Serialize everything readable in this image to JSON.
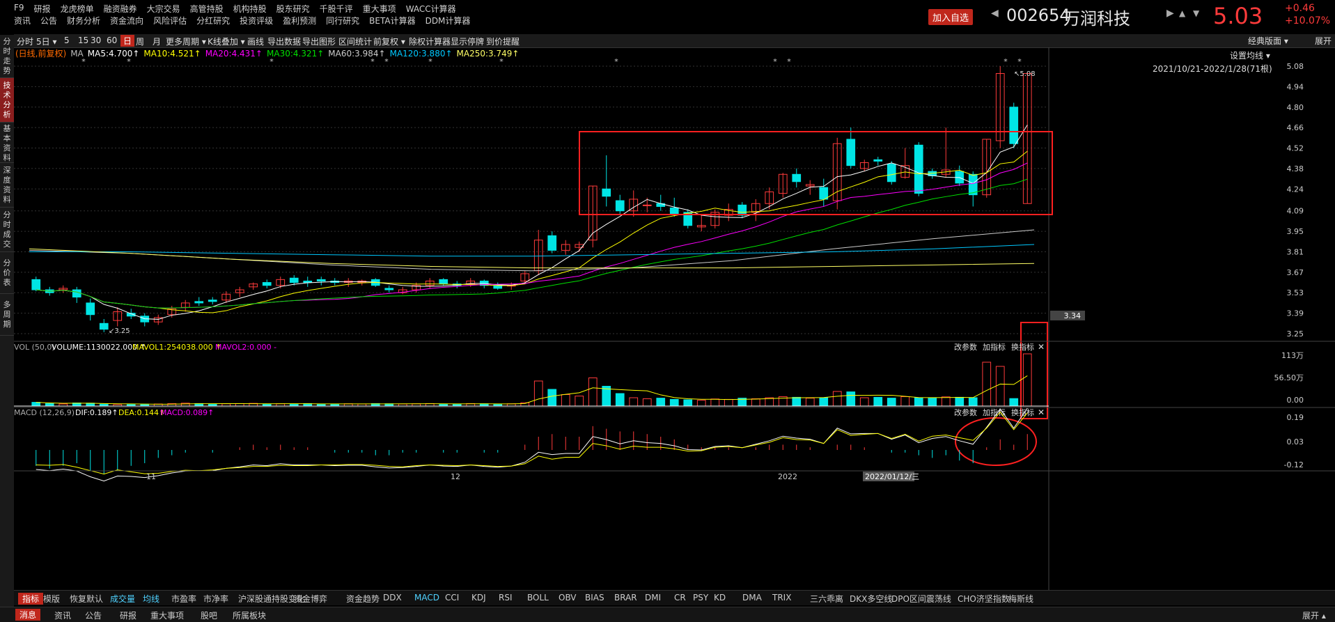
{
  "topnav": {
    "row1": [
      "F9",
      "研报",
      "龙虎榜单",
      "融资融券",
      "大宗交易",
      "高管持股",
      "机构持股",
      "股东研究",
      "千股千评",
      "重大事项",
      "WACC计算器"
    ],
    "row2": [
      "资讯",
      "公告",
      "财务分析",
      "资金流向",
      "风险评估",
      "分红研究",
      "投资评级",
      "盈利预测",
      "同行研究",
      "BETA计算器",
      "DDM计算器"
    ],
    "add_watch": "加入自选",
    "code": "002654",
    "name": "万润科技",
    "price": "5.03",
    "change": "+0.46",
    "change_pct": "+10.07%",
    "price_color": "#ff3b3b"
  },
  "left_tabs": [
    "分时走势",
    "技术分析",
    "基本资料",
    "深度资料",
    "分时成交",
    "分价表",
    "多周期"
  ],
  "toolbar": {
    "items": [
      "分时",
      "5日",
      "5",
      "15",
      "30",
      "60",
      "日",
      "周",
      "月",
      "更多周期",
      "K线叠加",
      "画线",
      "导出数据",
      "导出图形",
      "区间统计",
      "前复权",
      "除权计算器",
      "显示停牌",
      "到价提醒"
    ],
    "active": "日",
    "right_label": "经典版面",
    "expand": "展开"
  },
  "ma_legend": {
    "mode": "(日线,前复权)",
    "items": [
      {
        "label": "MA",
        "color": "#bbbbbb"
      },
      {
        "label": "MA5:4.700↑",
        "color": "#ffffff"
      },
      {
        "label": "MA10:4.521↑",
        "color": "#ffff00"
      },
      {
        "label": "MA20:4.431↑",
        "color": "#ff00ff"
      },
      {
        "label": "MA30:4.321↑",
        "color": "#00e000"
      },
      {
        "label": "MA60:3.984↑",
        "color": "#cccccc"
      },
      {
        "label": "MA120:3.880↑",
        "color": "#00c8ff"
      },
      {
        "label": "MA250:3.749↑",
        "color": "#ffff66"
      }
    ],
    "settings": "设置均线",
    "range": "2021/10/21-2022/1/28(71根)"
  },
  "price_axis": [
    "5.08",
    "4.94",
    "4.80",
    "4.66",
    "4.52",
    "4.38",
    "4.24",
    "4.09",
    "3.95",
    "3.81",
    "3.67",
    "3.53",
    "3.39",
    "3.25"
  ],
  "price_current_tag": "3.34",
  "annotations": {
    "high": "5.08",
    "low": "3.25"
  },
  "volume": {
    "title": "VOL (50,0)",
    "volume": "VOLUME:1130022.000 ↑",
    "mavol1": "MAVOL1:254038.000 ↑",
    "mavol2": "MAVOL2:0.000 -",
    "axis": [
      "113万",
      "56.50万",
      "0.00"
    ],
    "buttons": [
      "改参数",
      "加指标",
      "换指标"
    ]
  },
  "macd": {
    "title": "MACD (12,26,9)",
    "dif": "DIF:0.189↑",
    "dea": "DEA:0.144↑",
    "macd": "MACD:0.089↑",
    "axis": [
      "0.19",
      "0.03",
      "-0.12"
    ],
    "buttons": [
      "改参数",
      "加指标",
      "换指标"
    ]
  },
  "date_axis": {
    "labels": [
      "11",
      "12",
      "2022"
    ],
    "cursor": "2022/01/12/三"
  },
  "indicator_tabs": [
    "指标",
    "模版",
    "恢复默认",
    "成交量",
    "均线",
    "市盈率",
    "市净率",
    "沪深股通持股变化",
    "资金博弈",
    "资金趋势",
    "DDX",
    "MACD",
    "CCI",
    "KDJ",
    "RSI",
    "BOLL",
    "OBV",
    "BIAS",
    "BRAR",
    "DMI",
    "CR",
    "PSY",
    "KD",
    "DMA",
    "TRIX",
    "三六乖离",
    "DKX多空线",
    "DPO区间震荡线",
    "CHO济坚指数",
    "梅斯线"
  ],
  "status_tabs": [
    "消息",
    "资讯",
    "公告",
    "研报",
    "重大事项",
    "股吧",
    "所属板块"
  ],
  "status_right": "展开",
  "chart_data": {
    "type": "candlestick",
    "candles": [
      [
        3.62,
        3.55,
        3.64,
        3.54
      ],
      [
        3.55,
        3.53,
        3.57,
        3.51
      ],
      [
        3.55,
        3.56,
        3.58,
        3.53
      ],
      [
        3.55,
        3.5,
        3.57,
        3.46
      ],
      [
        3.46,
        3.38,
        3.49,
        3.34
      ],
      [
        3.32,
        3.28,
        3.35,
        3.26
      ],
      [
        3.34,
        3.4,
        3.43,
        3.3
      ],
      [
        3.39,
        3.37,
        3.42,
        3.35
      ],
      [
        3.37,
        3.33,
        3.39,
        3.3
      ],
      [
        3.33,
        3.36,
        3.38,
        3.31
      ],
      [
        3.38,
        3.42,
        3.44,
        3.36
      ],
      [
        3.43,
        3.46,
        3.48,
        3.4
      ],
      [
        3.47,
        3.46,
        3.5,
        3.44
      ],
      [
        3.48,
        3.47,
        3.5,
        3.45
      ],
      [
        3.48,
        3.52,
        3.54,
        3.46
      ],
      [
        3.53,
        3.55,
        3.57,
        3.5
      ],
      [
        3.57,
        3.59,
        3.6,
        3.55
      ],
      [
        3.6,
        3.58,
        3.62,
        3.56
      ],
      [
        3.58,
        3.62,
        3.64,
        3.56
      ],
      [
        3.63,
        3.6,
        3.65,
        3.58
      ],
      [
        3.61,
        3.6,
        3.64,
        3.57
      ],
      [
        3.62,
        3.61,
        3.64,
        3.58
      ],
      [
        3.61,
        3.6,
        3.63,
        3.58
      ],
      [
        3.6,
        3.61,
        3.63,
        3.57
      ],
      [
        3.6,
        3.61,
        3.62,
        3.58
      ],
      [
        3.62,
        3.58,
        3.63,
        3.57
      ],
      [
        3.56,
        3.55,
        3.58,
        3.53
      ],
      [
        3.53,
        3.55,
        3.57,
        3.52
      ],
      [
        3.55,
        3.58,
        3.6,
        3.53
      ],
      [
        3.58,
        3.61,
        3.63,
        3.56
      ],
      [
        3.62,
        3.59,
        3.63,
        3.58
      ],
      [
        3.59,
        3.58,
        3.61,
        3.56
      ],
      [
        3.59,
        3.61,
        3.63,
        3.57
      ],
      [
        3.61,
        3.58,
        3.62,
        3.56
      ],
      [
        3.58,
        3.56,
        3.6,
        3.55
      ],
      [
        3.58,
        3.58,
        3.6,
        3.55
      ],
      [
        3.61,
        3.66,
        3.68,
        3.59
      ],
      [
        3.68,
        3.89,
        3.96,
        3.65
      ],
      [
        3.92,
        3.82,
        3.95,
        3.8
      ],
      [
        3.82,
        3.86,
        3.89,
        3.79
      ],
      [
        3.84,
        3.86,
        3.88,
        3.81
      ],
      [
        3.89,
        4.26,
        4.26,
        3.84
      ],
      [
        4.24,
        4.19,
        4.47,
        4.12
      ],
      [
        4.16,
        4.09,
        4.2,
        4.06
      ],
      [
        4.09,
        4.17,
        4.23,
        4.05
      ],
      [
        4.13,
        4.13,
        4.18,
        4.08
      ],
      [
        4.14,
        4.12,
        4.2,
        4.09
      ],
      [
        4.11,
        4.07,
        4.18,
        4.05
      ],
      [
        4.08,
        3.99,
        4.1,
        3.97
      ],
      [
        3.98,
        3.99,
        4.06,
        3.95
      ],
      [
        3.99,
        4.08,
        4.1,
        3.97
      ],
      [
        4.06,
        4.1,
        4.14,
        4.02
      ],
      [
        4.13,
        4.06,
        4.15,
        4.04
      ],
      [
        4.08,
        4.14,
        4.17,
        4.02
      ],
      [
        4.14,
        4.22,
        4.25,
        4.1
      ],
      [
        4.21,
        4.34,
        4.35,
        4.18
      ],
      [
        4.34,
        4.29,
        4.38,
        4.25
      ],
      [
        4.26,
        4.27,
        4.3,
        4.2
      ],
      [
        4.25,
        4.17,
        4.31,
        4.12
      ],
      [
        4.16,
        4.55,
        4.59,
        4.1
      ],
      [
        4.58,
        4.4,
        4.66,
        4.38
      ],
      [
        4.38,
        4.42,
        4.44,
        4.36
      ],
      [
        4.44,
        4.43,
        4.46,
        4.4
      ],
      [
        4.41,
        4.29,
        4.43,
        4.27
      ],
      [
        4.32,
        4.4,
        4.52,
        4.31
      ],
      [
        4.54,
        4.21,
        4.56,
        4.19
      ],
      [
        4.36,
        4.33,
        4.38,
        4.31
      ],
      [
        4.34,
        4.37,
        4.66,
        4.32
      ],
      [
        4.36,
        4.28,
        4.4,
        4.26
      ],
      [
        4.34,
        4.2,
        4.36,
        4.12
      ],
      [
        4.2,
        4.58,
        4.58,
        4.18
      ],
      [
        4.57,
        5.03,
        5.08,
        4.52
      ],
      [
        4.8,
        4.55,
        4.83,
        4.52
      ],
      [
        4.14,
        5.03,
        5.03,
        4.14
      ]
    ],
    "volume": [
      18,
      12,
      10,
      15,
      14,
      9,
      7,
      8,
      9,
      10,
      12,
      14,
      12,
      9,
      11,
      12,
      13,
      10,
      11,
      10,
      12,
      10,
      9,
      11,
      10,
      12,
      11,
      10,
      11,
      12,
      10,
      9,
      12,
      11,
      10,
      11,
      16,
      120,
      80,
      55,
      48,
      135,
      95,
      60,
      40,
      35,
      38,
      32,
      30,
      28,
      34,
      32,
      38,
      35,
      40,
      45,
      42,
      38,
      40,
      70,
      68,
      40,
      42,
      38,
      45,
      40,
      38,
      44,
      42,
      40,
      210,
      190,
      36,
      250
    ],
    "macd_hist": [
      -0.06,
      -0.07,
      -0.06,
      -0.05,
      -0.08,
      -0.09,
      -0.08,
      -0.06,
      -0.05,
      -0.03,
      -0.02,
      -0.01,
      0.0,
      -0.01,
      0.0,
      0.01,
      0.02,
      0.01,
      0.02,
      0.01,
      0.01,
      0.0,
      -0.01,
      -0.01,
      -0.01,
      -0.02,
      -0.02,
      -0.01,
      -0.01,
      0.0,
      -0.01,
      -0.01,
      0.0,
      -0.01,
      -0.01,
      0.0,
      0.02,
      0.05,
      0.06,
      0.05,
      0.05,
      0.09,
      0.08,
      0.07,
      0.07,
      0.06,
      0.05,
      0.04,
      0.02,
      0.01,
      0.01,
      0.01,
      0.0,
      0.01,
      0.02,
      0.02,
      0.02,
      0.01,
      0.0,
      0.02,
      0.02,
      0.01,
      0.0,
      -0.01,
      -0.01,
      -0.02,
      -0.03,
      -0.02,
      -0.04,
      -0.05,
      0.01,
      0.04,
      0.02,
      0.06
    ]
  }
}
